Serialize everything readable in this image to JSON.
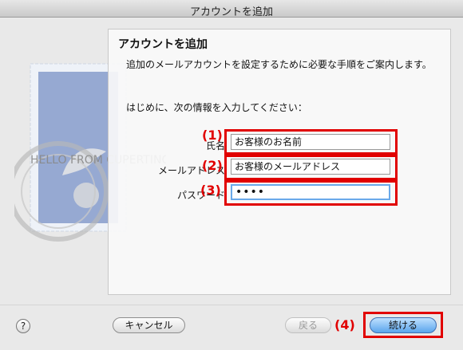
{
  "window": {
    "title": "アカウントを追加"
  },
  "panel": {
    "heading": "アカウントを追加",
    "description": "追加のメールアカウントを設定するために必要な手順をご案内します。",
    "prompt": "はじめに、次の情報を入力してください："
  },
  "fields": [
    {
      "label": "氏名",
      "value": "お客様のお名前",
      "callout": "(1)"
    },
    {
      "label": "メールアドレス",
      "value": "お客様のメールアドレス",
      "callout": "(2)"
    },
    {
      "label": "パスワード",
      "value": "••••",
      "callout": "(3)"
    }
  ],
  "buttons": {
    "help": "?",
    "cancel": "キャンセル",
    "back": "戻る",
    "back_callout": "(4)",
    "continue": "続ける"
  },
  "stamp": {
    "ring_text": "HELLO FROM CUPERTINO CA"
  },
  "colors": {
    "callout_red": "#e10000",
    "primary_blue": "#5aa5ec"
  }
}
